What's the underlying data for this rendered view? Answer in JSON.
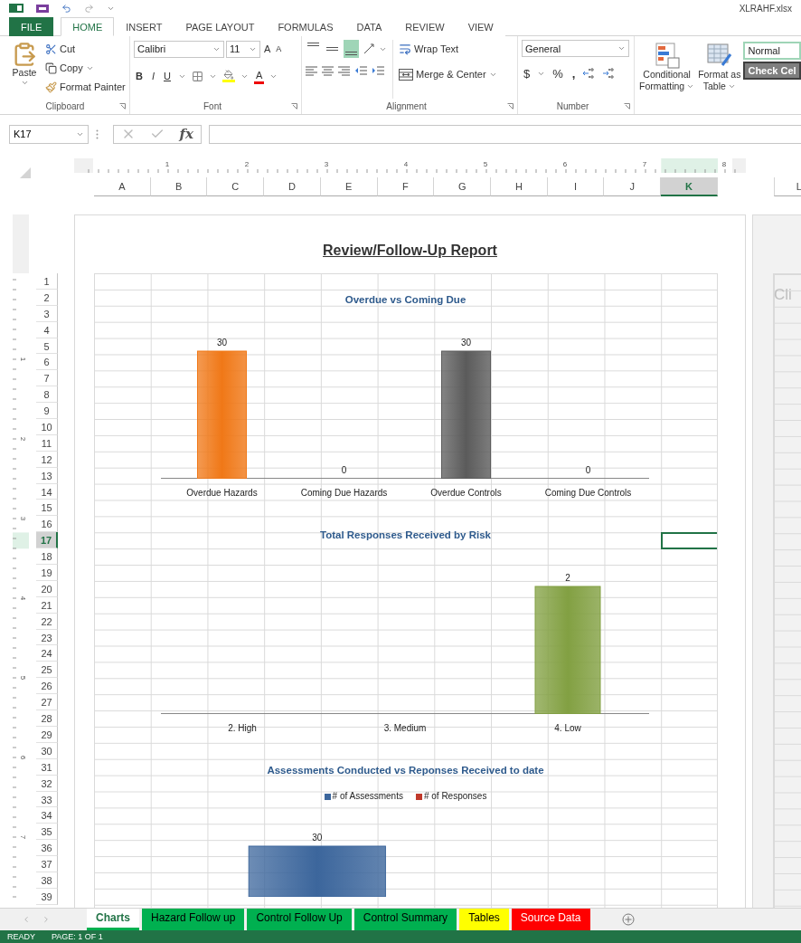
{
  "title_bar": {
    "file_name": "XLRAHF.xlsx"
  },
  "ribbon_tabs": [
    {
      "label": "FILE",
      "kind": "file",
      "selected": false
    },
    {
      "label": "HOME",
      "kind": "tab",
      "selected": true
    },
    {
      "label": "INSERT",
      "kind": "tab",
      "selected": false
    },
    {
      "label": "PAGE LAYOUT",
      "kind": "tab",
      "selected": false
    },
    {
      "label": "FORMULAS",
      "kind": "tab",
      "selected": false
    },
    {
      "label": "DATA",
      "kind": "tab",
      "selected": false
    },
    {
      "label": "REVIEW",
      "kind": "tab",
      "selected": false
    },
    {
      "label": "VIEW",
      "kind": "tab",
      "selected": false
    }
  ],
  "clipboard": {
    "label": "Clipboard",
    "paste": "Paste",
    "cut": "Cut",
    "copy": "Copy",
    "format_painter": "Format Painter"
  },
  "font": {
    "label": "Font",
    "family": "Calibri",
    "size": "11",
    "grow": "A",
    "shrink": "A",
    "styles": [
      "B",
      "I",
      "U"
    ],
    "font_color": "A"
  },
  "alignment": {
    "label": "Alignment",
    "wrap_text": "Wrap Text",
    "merge_center": "Merge & Center",
    "vertical": [
      {
        "kind": "top",
        "selected": false
      },
      {
        "kind": "middle",
        "selected": false
      },
      {
        "kind": "bottom",
        "selected": true
      }
    ]
  },
  "number": {
    "label": "Number",
    "format": "General",
    "symbols": [
      "$",
      "%",
      ","
    ]
  },
  "styles": {
    "conditional_formatting": [
      "Conditional",
      "Formatting"
    ],
    "format_as_table": [
      "Format as",
      "Table"
    ],
    "gallery": [
      {
        "label": "Normal",
        "kind": "normal"
      },
      {
        "label": "Check Cel",
        "kind": "check"
      }
    ]
  },
  "formula_bar": {
    "name_box": "K17",
    "fx": "fx"
  },
  "ruler": {
    "marks": [
      "1",
      "2",
      "3",
      "4",
      "5",
      "6",
      "7",
      "8"
    ]
  },
  "vertical_ruler": {
    "marks": [
      "1",
      "2",
      "3",
      "4",
      "5",
      "6",
      "7"
    ]
  },
  "columns": [
    {
      "label": "A",
      "selected": false
    },
    {
      "label": "B",
      "selected": false
    },
    {
      "label": "C",
      "selected": false
    },
    {
      "label": "D",
      "selected": false
    },
    {
      "label": "E",
      "selected": false
    },
    {
      "label": "F",
      "selected": false
    },
    {
      "label": "G",
      "selected": false
    },
    {
      "label": "H",
      "selected": false
    },
    {
      "label": "I",
      "selected": false
    },
    {
      "label": "J",
      "selected": false
    },
    {
      "label": "K",
      "selected": true
    }
  ],
  "rows": [
    {
      "label": "1",
      "selected": false
    },
    {
      "label": "2",
      "selected": false
    },
    {
      "label": "3",
      "selected": false
    },
    {
      "label": "4",
      "selected": false
    },
    {
      "label": "5",
      "selected": false
    },
    {
      "label": "6",
      "selected": false
    },
    {
      "label": "7",
      "selected": false
    },
    {
      "label": "8",
      "selected": false
    },
    {
      "label": "9",
      "selected": false
    },
    {
      "label": "10",
      "selected": false
    },
    {
      "label": "11",
      "selected": false
    },
    {
      "label": "12",
      "selected": false
    },
    {
      "label": "13",
      "selected": false
    },
    {
      "label": "14",
      "selected": false
    },
    {
      "label": "15",
      "selected": false
    },
    {
      "label": "16",
      "selected": false
    },
    {
      "label": "17",
      "selected": true
    },
    {
      "label": "18",
      "selected": false
    },
    {
      "label": "19",
      "selected": false
    },
    {
      "label": "20",
      "selected": false
    },
    {
      "label": "21",
      "selected": false
    },
    {
      "label": "22",
      "selected": false
    },
    {
      "label": "23",
      "selected": false
    },
    {
      "label": "24",
      "selected": false
    },
    {
      "label": "25",
      "selected": false
    },
    {
      "label": "26",
      "selected": false
    },
    {
      "label": "27",
      "selected": false
    },
    {
      "label": "28",
      "selected": false
    },
    {
      "label": "29",
      "selected": false
    },
    {
      "label": "30",
      "selected": false
    },
    {
      "label": "31",
      "selected": false
    },
    {
      "label": "32",
      "selected": false
    },
    {
      "label": "33",
      "selected": false
    },
    {
      "label": "34",
      "selected": false
    },
    {
      "label": "35",
      "selected": false
    },
    {
      "label": "36",
      "selected": false
    },
    {
      "label": "37",
      "selected": false
    },
    {
      "label": "38",
      "selected": false
    },
    {
      "label": "39",
      "selected": false
    }
  ],
  "report": {
    "title": "Review/Follow-Up Report",
    "charts": [
      {
        "chart_data": {
          "type": "bar",
          "title": "Overdue vs Coming Due",
          "categories": [
            "Overdue Hazards",
            "Coming Due Hazards",
            "Overdue Controls",
            "Coming Due Controls"
          ],
          "values": [
            30,
            0,
            30,
            0
          ],
          "colors": [
            "#f07817",
            "#f07817",
            "#5b5b5b",
            "#5b5b5b"
          ],
          "data_labels": true
        }
      },
      {
        "chart_data": {
          "type": "bar",
          "title": "Total Responses Received by Risk",
          "categories": [
            "2. High",
            "3. Medium",
            "4. Low"
          ],
          "values": [
            null,
            null,
            2
          ],
          "colors": [
            "#82a042",
            "#82a042",
            "#82a042"
          ],
          "data_labels": true
        }
      },
      {
        "chart_data": {
          "type": "bar",
          "title": "Assessments Conducted vs Reponses Received to date",
          "series": [
            {
              "name": "# of Assessments",
              "color": "#3c669c",
              "values": [
                30
              ]
            },
            {
              "name": "# of Responses",
              "color": "#c0392b",
              "values": [
                null
              ]
            }
          ],
          "data_labels": true
        }
      }
    ]
  },
  "next_page": {
    "columns": [
      {
        "label": "L",
        "selected": false
      }
    ],
    "text": "Cli"
  },
  "sheet_tabs": [
    {
      "label": "Charts",
      "selected": true,
      "color": "#00b050"
    },
    {
      "label": "Hazard Follow up",
      "selected": false,
      "color": "#00b050"
    },
    {
      "label": "Control Follow Up",
      "selected": false,
      "color": "#00b050"
    },
    {
      "label": "Control Summary",
      "selected": false,
      "color": "#00b050"
    },
    {
      "label": "Tables",
      "selected": false,
      "color": "#ffff00"
    },
    {
      "label": "Source Data",
      "selected": false,
      "color": "#ff0000"
    }
  ],
  "status_bar": {
    "mode": "READY",
    "page": "PAGE: 1 OF 1"
  }
}
